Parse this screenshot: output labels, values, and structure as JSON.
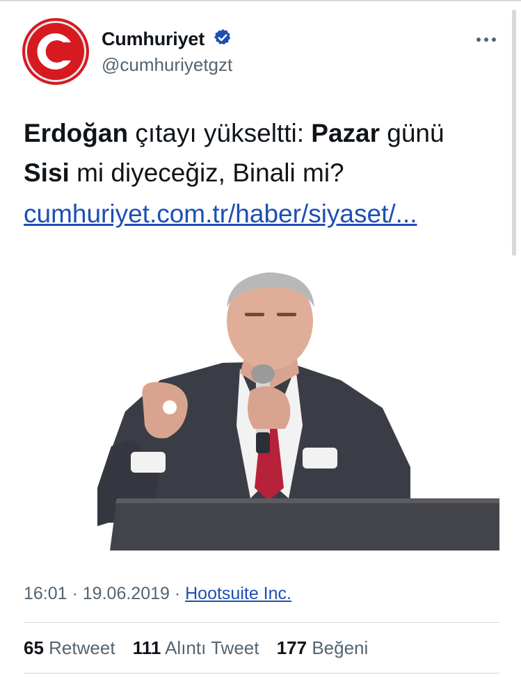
{
  "account": {
    "name": "Cumhuriyet",
    "handle": "@cumhuriyetgzt",
    "verified": true,
    "avatar_icon": "cumhuriyet-c-logo",
    "avatar_color": "#d71920"
  },
  "tweet": {
    "bold1": "Erdoğan",
    "text1": " çıtayı yükseltti: ",
    "bold2": "Pazar",
    "text2": " günü",
    "bold3": "Sisi",
    "text3": " mi diyeceğiz, Binali mi?",
    "link": "cumhuriyet.com.tr/haber/siyaset/..."
  },
  "media": {
    "icon": "speaker-photo"
  },
  "meta": {
    "time": "16:01",
    "sep": " · ",
    "date": "19.06.2019",
    "source": "Hootsuite Inc."
  },
  "stats": {
    "retweets": "65",
    "retweets_label": "Retweet",
    "quotes": "111",
    "quotes_label": "Alıntı Tweet",
    "likes": "177",
    "likes_label": "Beğeni"
  },
  "colors": {
    "link": "#1d4fb3",
    "verified": "#1d4fb3",
    "secondary_text": "#536471"
  }
}
